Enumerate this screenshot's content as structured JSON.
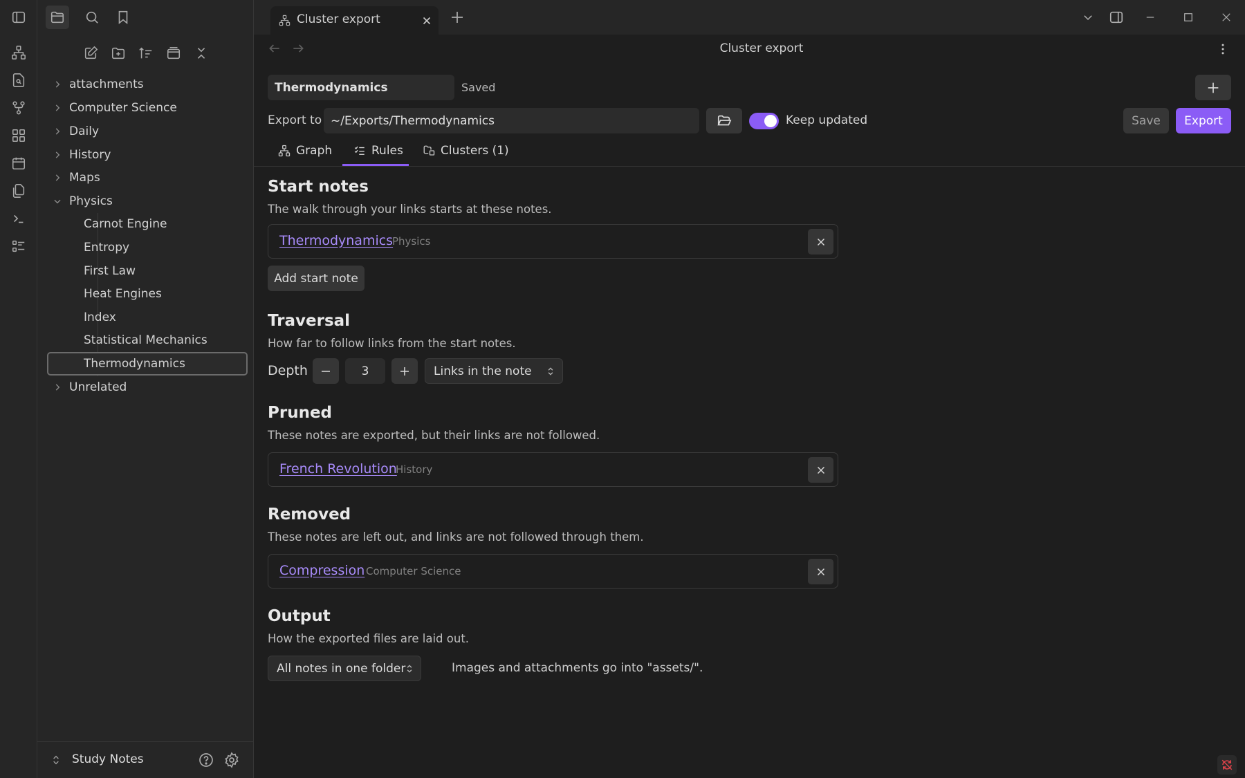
{
  "tab": {
    "title": "Cluster export"
  },
  "sidebar": {
    "tree": [
      {
        "label": "attachments",
        "type": "folder"
      },
      {
        "label": "Computer Science",
        "type": "folder"
      },
      {
        "label": "Daily",
        "type": "folder"
      },
      {
        "label": "History",
        "type": "folder"
      },
      {
        "label": "Maps",
        "type": "folder"
      },
      {
        "label": "Physics",
        "type": "folder-open"
      },
      {
        "label": "Carnot Engine",
        "type": "file"
      },
      {
        "label": "Entropy",
        "type": "file"
      },
      {
        "label": "First Law",
        "type": "file"
      },
      {
        "label": "Heat Engines",
        "type": "file"
      },
      {
        "label": "Index",
        "type": "file"
      },
      {
        "label": "Statistical Mechanics",
        "type": "file"
      },
      {
        "label": "Thermodynamics",
        "type": "file",
        "selected": true
      },
      {
        "label": "Unrelated",
        "type": "folder"
      }
    ],
    "vault_name": "Study Notes"
  },
  "view": {
    "title": "Cluster export",
    "name_value": "Thermodynamics",
    "status": "Saved",
    "export_to_label": "Export to",
    "export_path": "~/Exports/Thermodynamics",
    "keep_updated_label": "Keep updated",
    "keep_updated": true,
    "save_label": "Save",
    "export_label": "Export",
    "tabs": {
      "graph": "Graph",
      "rules": "Rules",
      "clusters": "Clusters (1)",
      "active": "Rules"
    }
  },
  "rules": {
    "start": {
      "heading": "Start notes",
      "desc": "The walk through your links starts at these notes.",
      "note": {
        "name": "Thermodynamics",
        "folder": "Physics"
      },
      "add_label": "Add start note"
    },
    "traversal": {
      "heading": "Traversal",
      "desc": "How far to follow links from the start notes.",
      "depth_label": "Depth",
      "depth_value": "3",
      "mode": "Links in the note"
    },
    "pruned": {
      "heading": "Pruned",
      "desc": "These notes are exported, but their links are not followed.",
      "note": {
        "name": "French Revolution",
        "folder": "History"
      }
    },
    "removed": {
      "heading": "Removed",
      "desc": "These notes are left out, and links are not followed through them.",
      "note": {
        "name": "Compression",
        "folder": "Computer Science"
      }
    },
    "output": {
      "heading": "Output",
      "desc": "How the exported files are laid out.",
      "layout": "All notes in one folder",
      "note": "Images and attachments go into \"assets/\"."
    }
  },
  "colors": {
    "accent": "#8b5cf6",
    "link": "#a88bfa",
    "background": "#1e1e1e",
    "sidebar": "#262626"
  }
}
